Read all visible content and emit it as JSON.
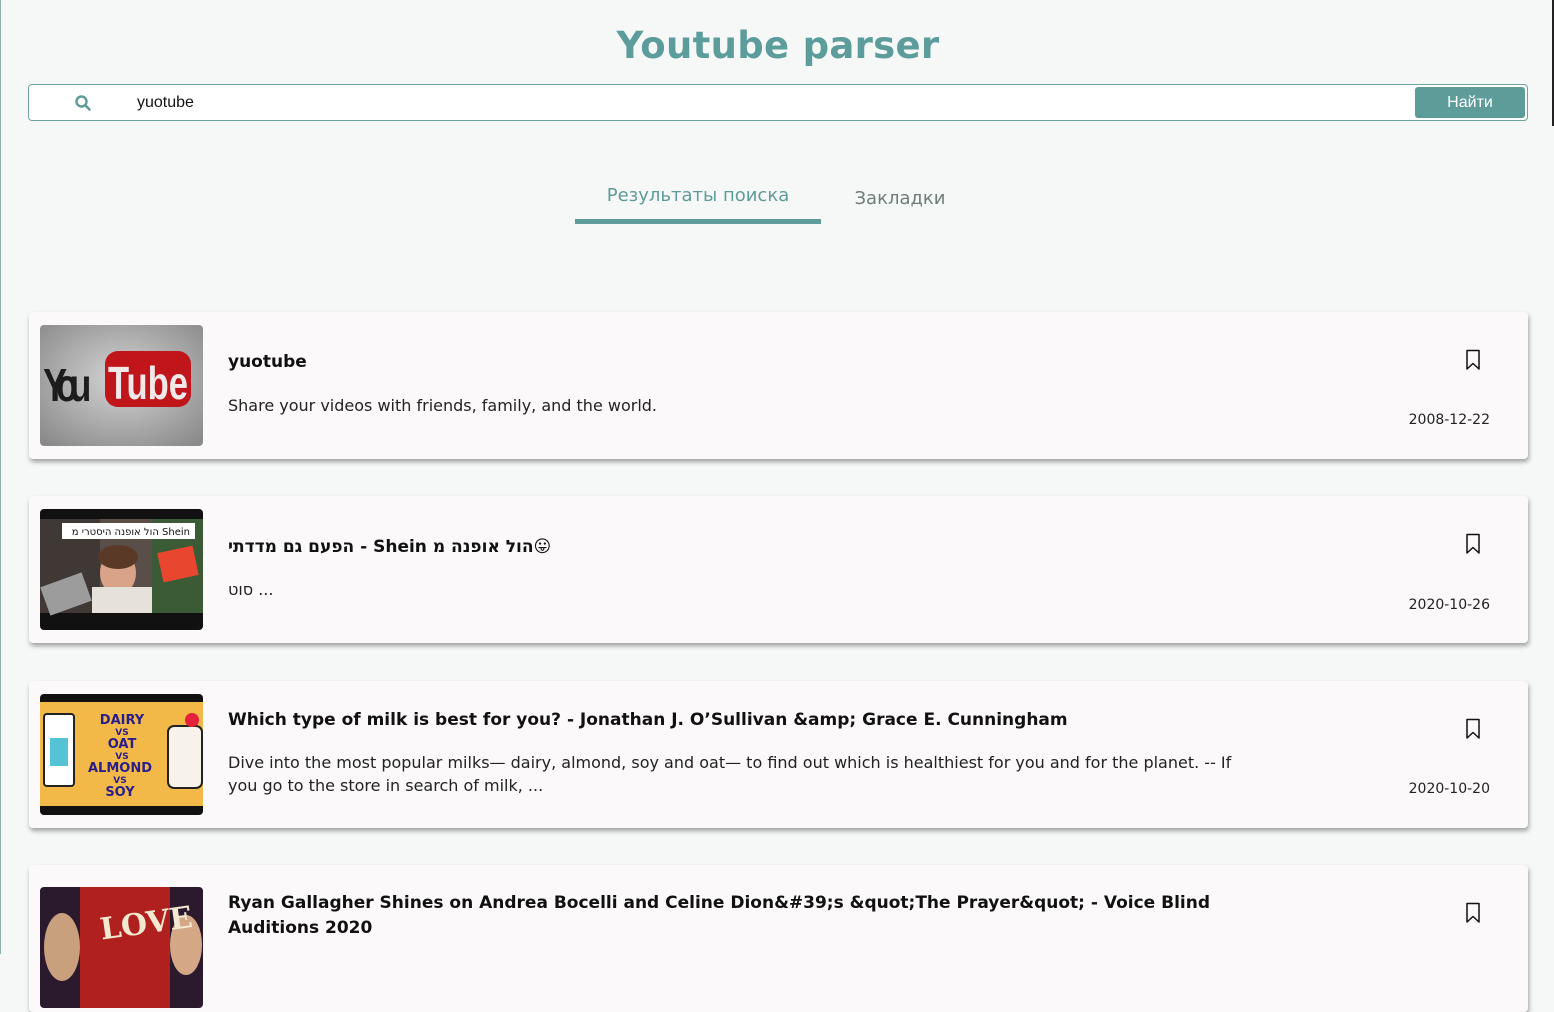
{
  "app": {
    "title": "Youtube parser"
  },
  "search": {
    "icon": "search-icon",
    "value": "yuotube",
    "button_label": "Найти"
  },
  "tabs": [
    {
      "label": "Результаты поиска",
      "active": true
    },
    {
      "label": "Закладки",
      "active": false
    }
  ],
  "colors": {
    "accent": "#5e9c9a",
    "background": "#f5f8f7",
    "card": "#fbf9fa"
  },
  "results": [
    {
      "title": "yuotube",
      "description": "Share your videos with friends, family, and the world.",
      "date": "2008-12-22",
      "bookmark_icon": "bookmark-outline-icon"
    },
    {
      "title": "הפעם גם מדדתי - Shein הול אופנה מ😛",
      "description": "סוט ...",
      "date": "2020-10-26",
      "bookmark_icon": "bookmark-outline-icon",
      "thumb_text": "הול אופנה היסטרי מ Shein"
    },
    {
      "title": "Which type of milk is best for you? - Jonathan J. O’Sullivan &amp; Grace E. Cunningham",
      "description": "Dive into the most popular milks— dairy, almond, soy and oat— to find out which is healthiest for you and for the planet. -- If you go to the store in search of milk, ...",
      "date": "2020-10-20",
      "bookmark_icon": "bookmark-outline-icon",
      "thumb_text": [
        "DAIRY",
        "VS",
        "OAT",
        "VS",
        "ALMOND",
        "VS",
        "SOY"
      ]
    },
    {
      "title": "Ryan Gallagher Shines on Andrea Bocelli and Celine Dion&#39;s &quot;The Prayer&quot; - Voice Blind Auditions 2020",
      "description": "",
      "date": "",
      "bookmark_icon": "bookmark-outline-icon"
    }
  ]
}
